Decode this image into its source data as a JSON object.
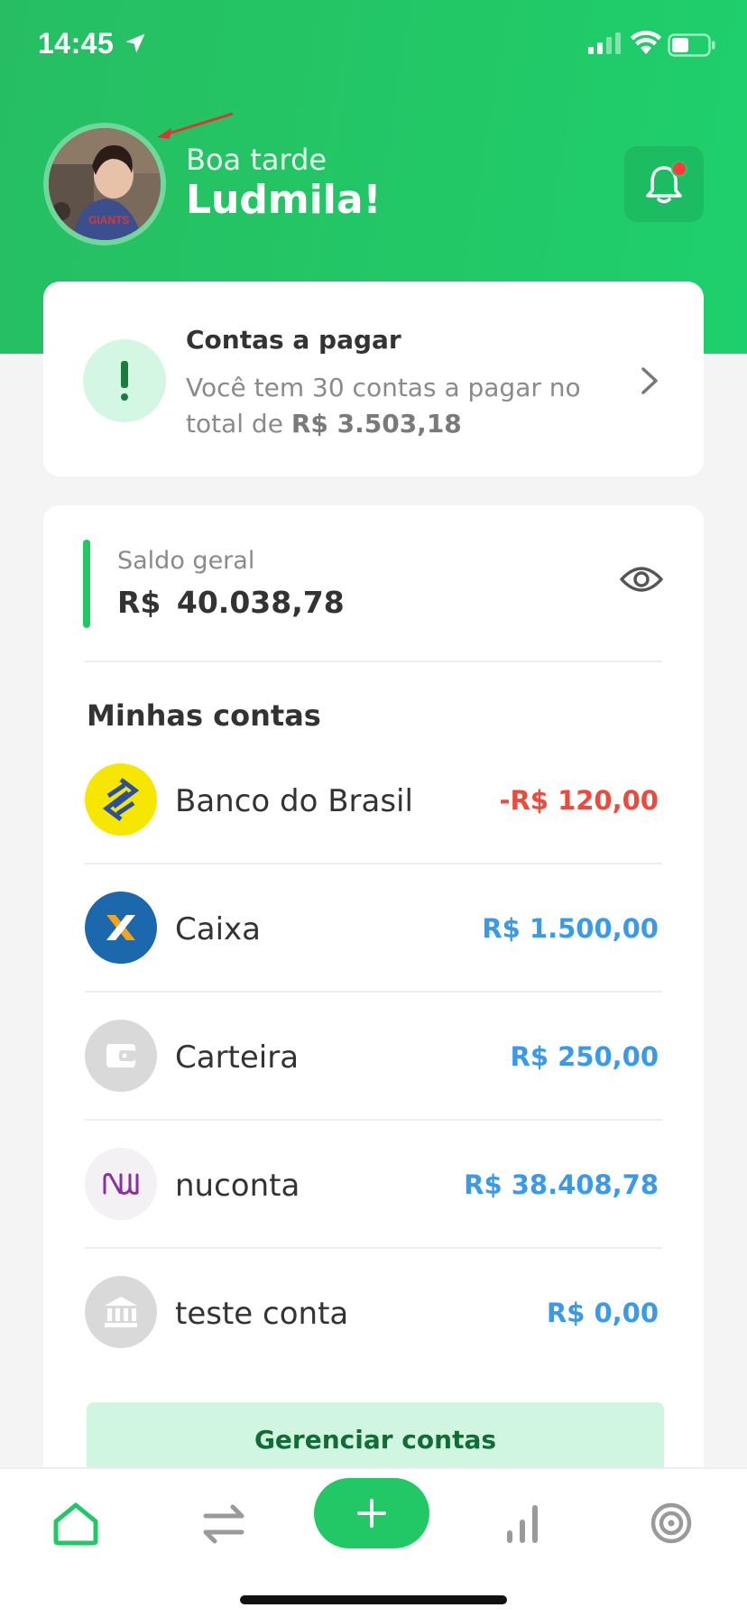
{
  "status_bar": {
    "time": "14:45"
  },
  "header": {
    "greeting": "Boa tarde",
    "user_name": "Ludmila!",
    "colors": {
      "primary_green": "#22c866",
      "notification_dot": "#ff3b3b"
    }
  },
  "bills": {
    "title": "Contas a pagar",
    "desc_prefix": "Você tem 30 contas a pagar no total de ",
    "desc_amount": "R$ 3.503,18"
  },
  "balance": {
    "label": "Saldo geral",
    "value": "R$  40.038,78"
  },
  "accounts": {
    "title": "Minhas contas",
    "items": [
      {
        "name": "Banco do Brasil",
        "value": "-R$ 120,00",
        "icon": "banco-do-brasil-logo",
        "value_color": "#ec4a3c"
      },
      {
        "name": "Caixa",
        "value": "R$ 1.500,00",
        "icon": "caixa-logo",
        "value_color": "#3a9ae8"
      },
      {
        "name": "Carteira",
        "value": "R$ 250,00",
        "icon": "wallet-icon",
        "value_color": "#3a9ae8"
      },
      {
        "name": "nuconta",
        "value": "R$ 38.408,78",
        "icon": "nubank-logo",
        "value_color": "#3a9ae8"
      },
      {
        "name": "teste conta",
        "value": "R$ 0,00",
        "icon": "bank-building-icon",
        "value_color": "#3a9ae8"
      }
    ],
    "manage_label": "Gerenciar contas"
  },
  "bottom_nav": {
    "items": [
      "home-icon",
      "transfer-icon",
      "add-icon",
      "chart-icon",
      "target-icon"
    ]
  }
}
